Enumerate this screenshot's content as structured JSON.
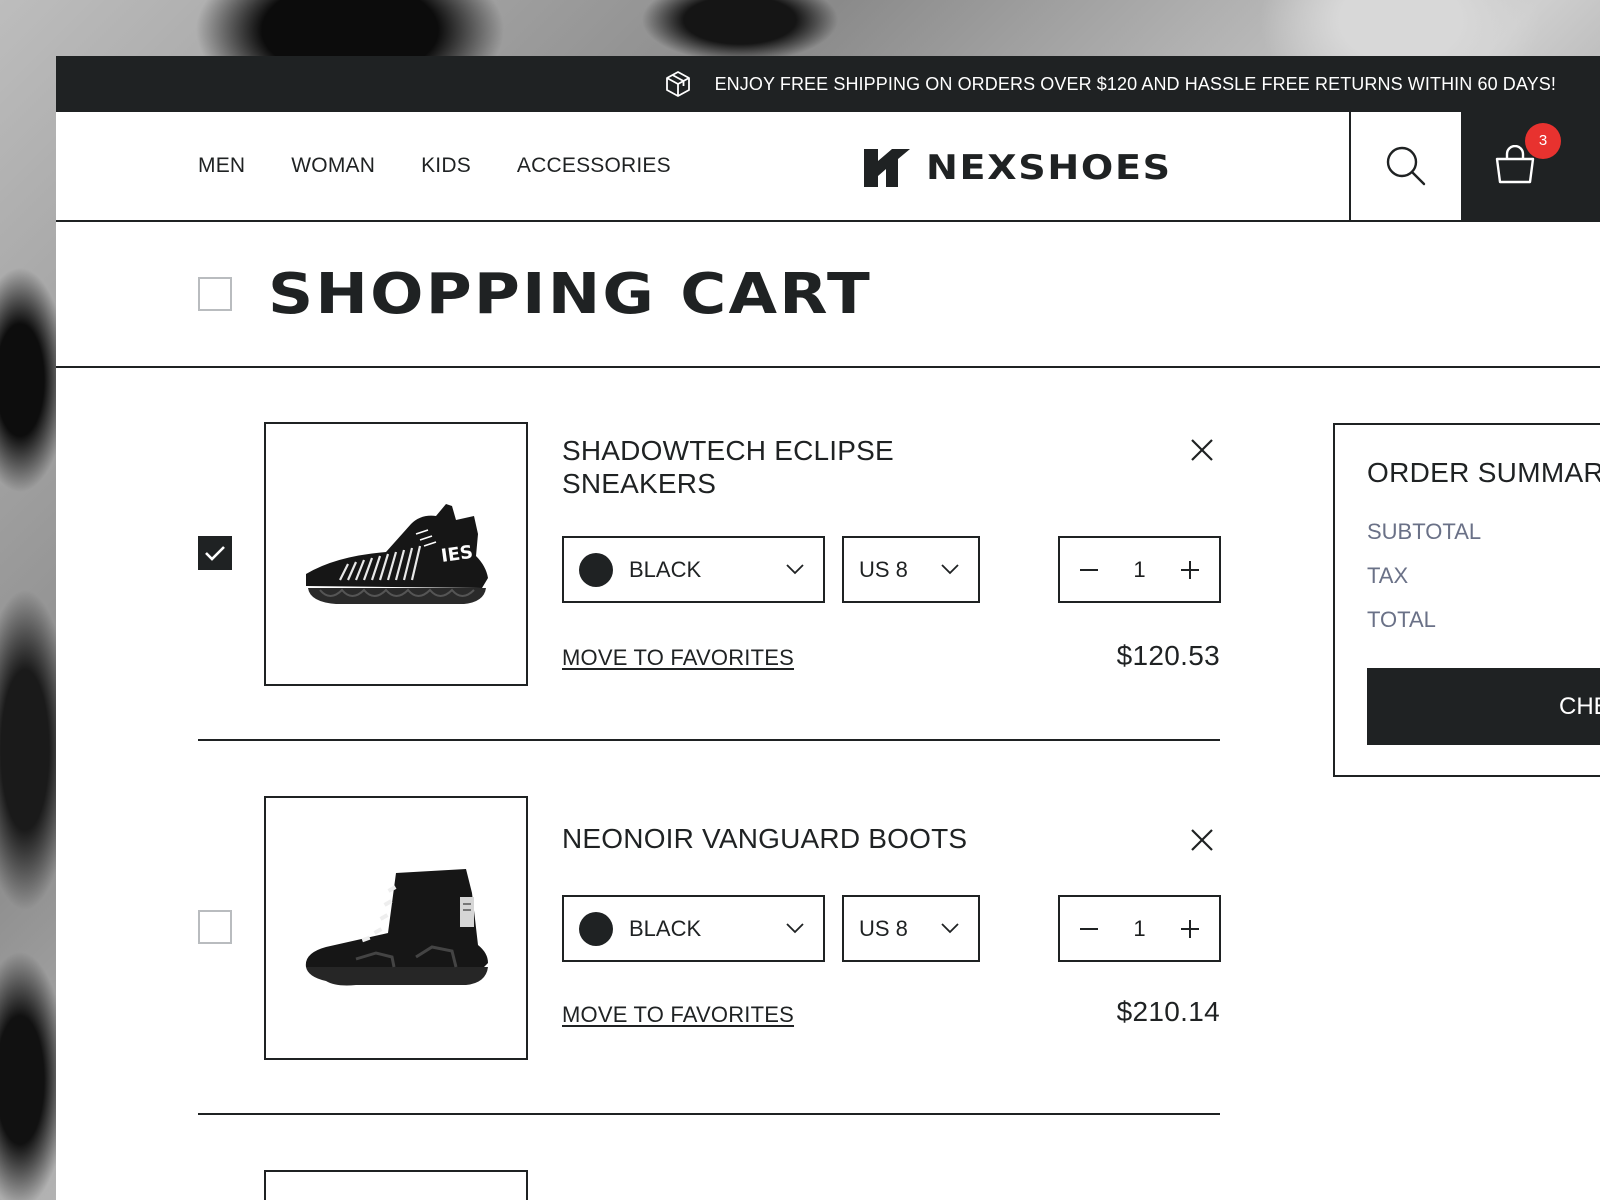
{
  "promo": {
    "text": "ENJOY FREE SHIPPING ON ORDERS OVER $120 AND HASSLE FREE RETURNS WITHIN 60 DAYS!",
    "icon": "package-box-icon"
  },
  "header": {
    "nav": [
      "MEN",
      "WOMAN",
      "KIDS",
      "ACCESSORIES"
    ],
    "logo_text": "NEXSHOES",
    "cart_count": "3"
  },
  "page_title": "SHOPPING CART",
  "items": [
    {
      "name_line1": "SHADOWTECH ECLIPSE",
      "name_line2": "SNEAKERS",
      "color": "BLACK",
      "size": "US 8",
      "quantity": "1",
      "favorites_label": "MOVE TO FAVORITES",
      "price": "$120.53",
      "selected": true
    },
    {
      "name_line1": "NEONOIR VANGUARD BOOTS",
      "name_line2": "",
      "color": "BLACK",
      "size": "US 8",
      "quantity": "1",
      "favorites_label": "MOVE TO FAVORITES",
      "price": "$210.14",
      "selected": false
    }
  ],
  "summary": {
    "title": "ORDER SUMMARY",
    "subtotal_label": "SUBTOTAL",
    "tax_label": "TAX",
    "total_label": "TOTAL",
    "checkout_label": "CHECKOUT"
  },
  "colors": {
    "dark": "#1f2223",
    "badge": "#e8322f",
    "muted": "#6a7187",
    "accent_swatch": "#1f2223"
  }
}
